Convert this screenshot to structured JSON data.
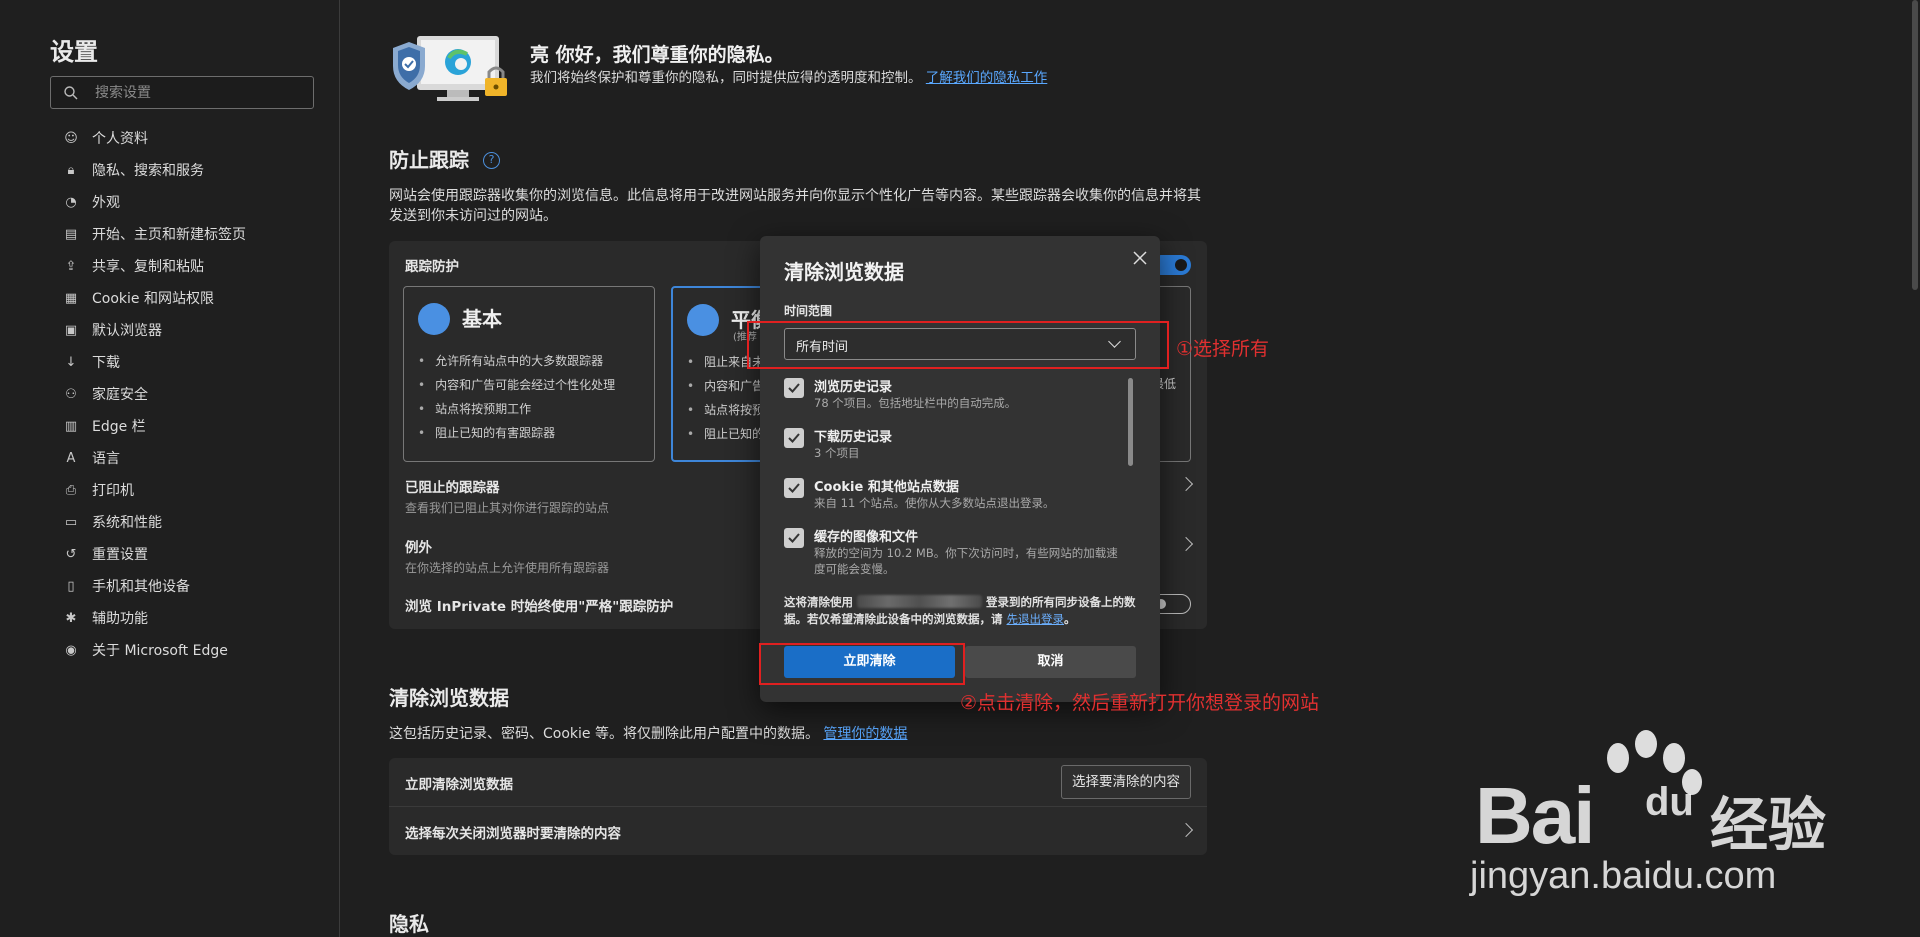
{
  "sidebar": {
    "title": "设置",
    "search_placeholder": "搜索设置",
    "items": [
      {
        "label": "个人资料",
        "icon": "profile-icon"
      },
      {
        "label": "隐私、搜索和服务",
        "icon": "lock-icon"
      },
      {
        "label": "外观",
        "icon": "palette-icon"
      },
      {
        "label": "开始、主页和新建标签页",
        "icon": "home-icon"
      },
      {
        "label": "共享、复制和粘贴",
        "icon": "share-icon"
      },
      {
        "label": "Cookie 和网站权限",
        "icon": "cookie-icon"
      },
      {
        "label": "默认浏览器",
        "icon": "browser-icon"
      },
      {
        "label": "下载",
        "icon": "download-icon"
      },
      {
        "label": "家庭安全",
        "icon": "family-icon"
      },
      {
        "label": "Edge 栏",
        "icon": "edge-bar-icon"
      },
      {
        "label": "语言",
        "icon": "language-icon"
      },
      {
        "label": "打印机",
        "icon": "printer-icon"
      },
      {
        "label": "系统和性能",
        "icon": "laptop-icon"
      },
      {
        "label": "重置设置",
        "icon": "reset-icon"
      },
      {
        "label": "手机和其他设备",
        "icon": "phone-icon"
      },
      {
        "label": "辅助功能",
        "icon": "accessibility-icon"
      },
      {
        "label": "关于 Microsoft Edge",
        "icon": "edge-logo-icon"
      }
    ]
  },
  "hero": {
    "title": "亮 你好，我们尊重你的隐私。",
    "desc": "我们将始终保护和尊重你的隐私，同时提供应得的透明度和控制。",
    "link": "了解我们的隐私工作"
  },
  "tracking": {
    "title": "防止跟踪",
    "desc": "网站会使用跟踪器收集你的浏览信息。此信息将用于改进网站服务并向你显示个性化广告等内容。某些跟踪器会收集你的信息并将其发送到你未访问过的网站。",
    "protection_label": "跟踪防护",
    "basic": {
      "title": "基本",
      "items": [
        "允许所有站点中的大多数跟踪器",
        "内容和广告可能会经过个性化处理",
        "站点将按预期工作",
        "阻止已知的有害跟踪器"
      ]
    },
    "balanced": {
      "title": "平衡",
      "sub": "(推荐",
      "items": [
        "阻止来自未",
        "内容和广告",
        "站点将按预",
        "阻止已知的"
      ]
    },
    "strict_tail": "最低",
    "blocked_title": "已阻止的跟踪器",
    "blocked_sub": "查看我们已阻止其对你进行跟踪的站点",
    "exceptions_title": "例外",
    "exceptions_sub": "在你选择的站点上允许使用所有跟踪器",
    "inprivate_label": "浏览 InPrivate 时始终使用\"严格\"跟踪防护"
  },
  "clear_section": {
    "title": "清除浏览数据",
    "desc": "这包括历史记录、密码、Cookie 等。将仅删除此用户配置中的数据。",
    "link": "管理你的数据",
    "row1_label": "立即清除浏览数据",
    "row1_button": "选择要清除的内容",
    "row2_label": "选择每次关闭浏览器时要清除的内容"
  },
  "privacy_section": {
    "title": "隐私"
  },
  "dialog": {
    "title": "清除浏览数据",
    "range_label": "时间范围",
    "range_value": "所有时间",
    "items": [
      {
        "title": "浏览历史记录",
        "sub": "78 个项目。包括地址栏中的自动完成。"
      },
      {
        "title": "下载历史记录",
        "sub": "3 个项目"
      },
      {
        "title": "Cookie 和其他站点数据",
        "sub": "来自 11 个站点。使你从大多数站点退出登录。"
      },
      {
        "title": "缓存的图像和文件",
        "sub": "释放的空间为 10.2 MB。你下次访问时，有些网站的加载速度可能会变慢。"
      }
    ],
    "note_pre": "这将清除使用",
    "note_mid": "登录到的所有同步设备上的数据。若仅希望清除此设备中的浏览数据，请",
    "note_link": "先退出登录",
    "note_end": "。",
    "clear_button": "立即清除",
    "cancel_button": "取消"
  },
  "annotations": {
    "step1": "①选择所有",
    "step2": "②点击清除，然后重新打开你想登录的网站"
  },
  "watermark": {
    "brand": "Bai",
    "du": "du",
    "jingyan": "经验",
    "url": "jingyan.baidu.com"
  },
  "colors": {
    "accent": "#1a6ec7",
    "annotation": "#e02020",
    "background": "#1f1f1f"
  }
}
